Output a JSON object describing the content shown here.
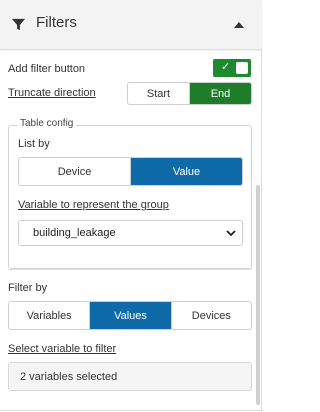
{
  "header": {
    "title": "Filters",
    "filter_icon": "filter-icon",
    "collapse_icon": "caret-up-icon"
  },
  "add_filter_button": {
    "label": "Add filter button",
    "enabled": true
  },
  "truncate_direction": {
    "label": "Truncate direction",
    "options": [
      "Start",
      "End"
    ],
    "selected": "End"
  },
  "table_config": {
    "legend": "Table config",
    "list_by": {
      "label": "List by",
      "options": [
        "Device",
        "Value"
      ],
      "selected": "Value"
    },
    "group_variable": {
      "label": "Variable to represent the group",
      "value": "building_leakage"
    }
  },
  "filter_by": {
    "label": "Filter by",
    "options": [
      "Variables",
      "Values",
      "Devices"
    ],
    "selected": "Values"
  },
  "select_variable": {
    "label": "Select variable to filter",
    "value": "2 variables selected"
  },
  "colors": {
    "green": "#1e7d2a",
    "blue": "#0f6aa8",
    "header_bg": "#f3f3f3"
  }
}
